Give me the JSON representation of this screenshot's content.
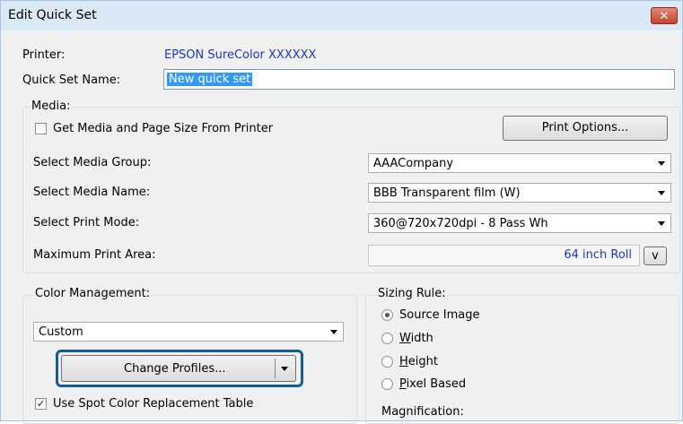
{
  "window": {
    "title": "Edit Quick Set",
    "close_label": "✕"
  },
  "printer": {
    "label": "Printer:",
    "value": "EPSON SureColor XXXXXX"
  },
  "quick_set_name": {
    "label": "Quick Set Name:",
    "value": "New quick set"
  },
  "media": {
    "group_label": "Media:",
    "get_from_printer_label": "Get Media and Page Size From Printer",
    "get_from_printer_checked": false,
    "print_options_label": "Print Options...",
    "media_group": {
      "label": "Select Media Group:",
      "value": "AAACompany"
    },
    "media_name": {
      "label": "Select Media Name:",
      "value": "BBB Transparent film (W)"
    },
    "print_mode": {
      "label": "Select Print Mode:",
      "value": "360@720x720dpi - 8 Pass Wh"
    },
    "max_area": {
      "label": "Maximum Print Area:",
      "value": "64 inch Roll",
      "button": "v"
    }
  },
  "color_management": {
    "group_label": "Color Management:",
    "value": "Custom",
    "change_profiles_label": "Change Profiles...",
    "spot_color_label": "Use Spot Color Replacement Table",
    "spot_color_checked": true
  },
  "sizing_rule": {
    "group_label": "Sizing Rule:",
    "options": [
      {
        "label": "Source Image",
        "selected": true
      },
      {
        "label": "Width",
        "selected": false
      },
      {
        "label": "Height",
        "selected": false
      },
      {
        "label": "Pixel Based",
        "selected": false
      }
    ],
    "magnification_label": "Magnification:"
  }
}
